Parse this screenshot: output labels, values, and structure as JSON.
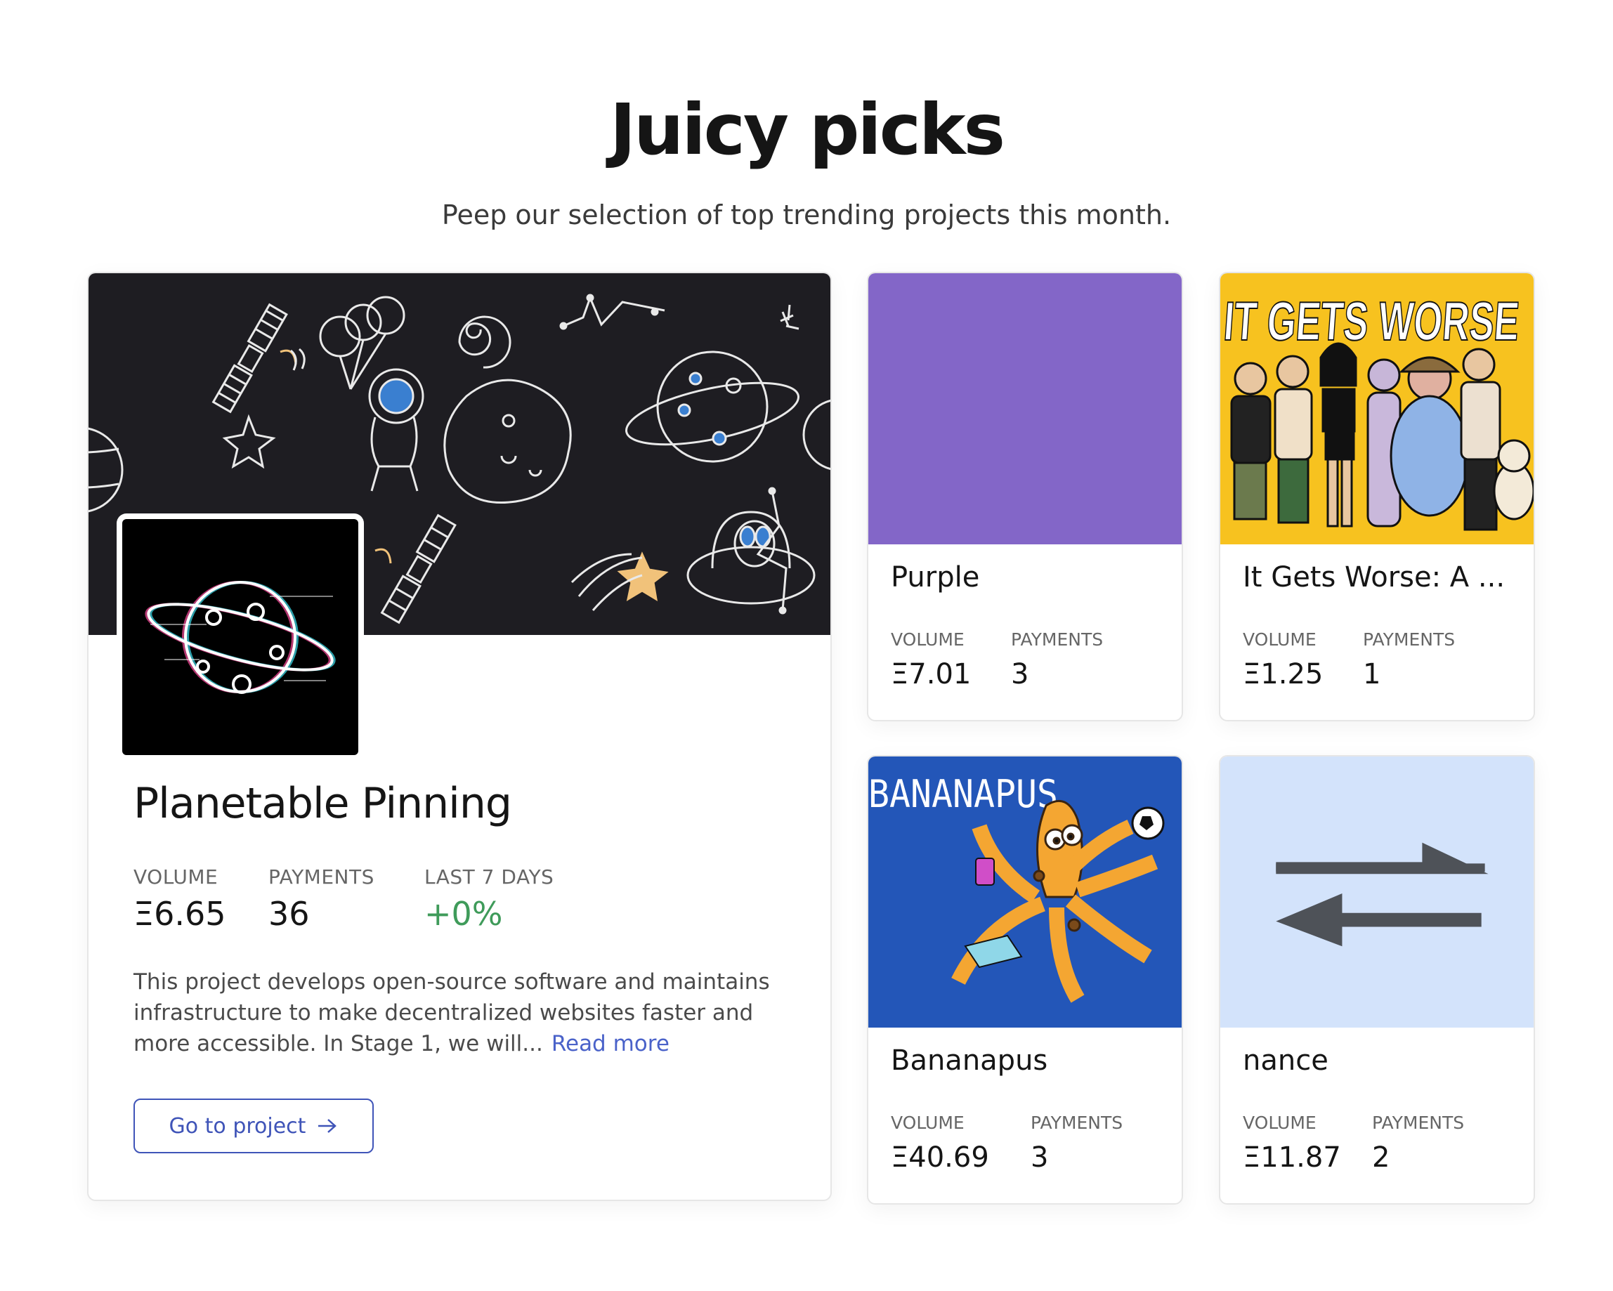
{
  "header": {
    "title": "Juicy picks",
    "subtitle": "Peep our selection of top trending projects this month."
  },
  "featured": {
    "name": "Planetable Pinning",
    "stats": {
      "volume_label": "VOLUME",
      "volume_value": "Ξ6.65",
      "payments_label": "PAYMENTS",
      "payments_value": "36",
      "last7_label": "LAST 7 DAYS",
      "last7_value": "+0%"
    },
    "description": "This project develops open-source software and maintains infrastructure to make decentralized websites faster and more accessible. In Stage 1, we will...",
    "read_more": "Read more",
    "button_label": "Go to project"
  },
  "cards": [
    {
      "name": "Purple",
      "thumb_color": "#8366c8",
      "volume_label": "VOLUME",
      "volume_value": "Ξ7.01",
      "payments_label": "PAYMENTS",
      "payments_value": "3"
    },
    {
      "name": "It Gets Worse: A ...",
      "thumb_text": "IT GETS WORSE",
      "thumb_color": "#f7c21f",
      "volume_label": "VOLUME",
      "volume_value": "Ξ1.25",
      "payments_label": "PAYMENTS",
      "payments_value": "1"
    },
    {
      "name": "Bananapus",
      "thumb_text": "BANANAPUS",
      "thumb_color": "#2356b8",
      "volume_label": "VOLUME",
      "volume_value": "Ξ40.69",
      "payments_label": "PAYMENTS",
      "payments_value": "3"
    },
    {
      "name": "nance",
      "thumb_color": "#d3e3fb",
      "volume_label": "VOLUME",
      "volume_value": "Ξ11.87",
      "payments_label": "PAYMENTS",
      "payments_value": "2"
    }
  ],
  "colors": {
    "accent": "#3f54b8",
    "positive": "#3f9b5a",
    "banner_bg": "#1e1d22"
  },
  "icons": [
    "arrow-right-icon",
    "swap-arrows-icon",
    "planet-logo-icon"
  ]
}
